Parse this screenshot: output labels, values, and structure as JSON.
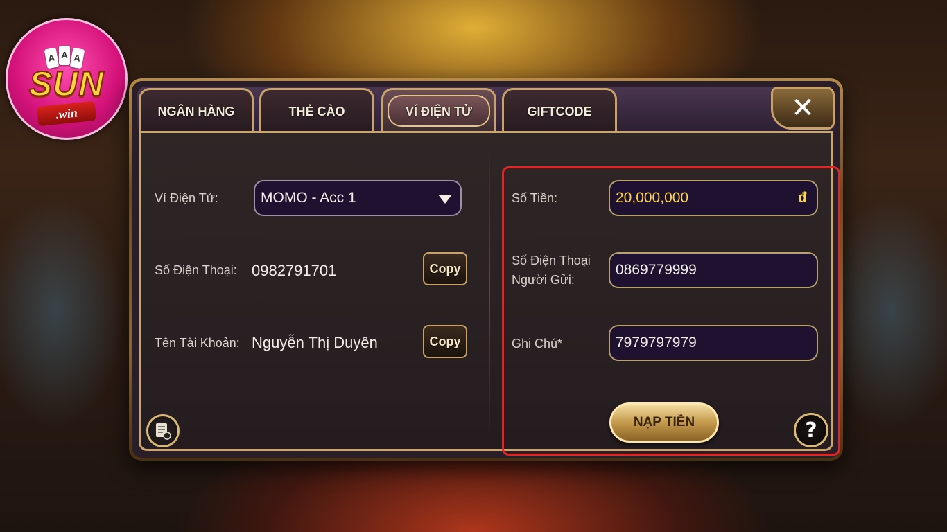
{
  "logo": {
    "brand": "SUN",
    "sub": ".win",
    "cards": [
      "A",
      "A",
      "A"
    ]
  },
  "tabs": [
    {
      "label": "NGÂN HÀNG",
      "active": false
    },
    {
      "label": "THẺ CÀO",
      "active": false
    },
    {
      "label": "VÍ ĐIỆN TỬ",
      "active": true
    },
    {
      "label": "GIFTCODE",
      "active": false
    }
  ],
  "close_icon": "close-icon",
  "left": {
    "wallet_label": "Ví Điện Tử:",
    "wallet_selected": "MOMO - Acc 1",
    "phone_label": "Số Điện Thoại:",
    "phone_value": "0982791701",
    "account_label": "Tên Tài Khoản:",
    "account_value": "Nguyễn Thị Duyên",
    "copy_label": "Copy"
  },
  "right": {
    "amount_label": "Số Tiền:",
    "amount_value": "20,000,000",
    "currency": "đ",
    "sender_label_line1": "Số Điện Thoại",
    "sender_label_line2": "Người Gửi:",
    "sender_value": "0869779999",
    "note_label": "Ghi Chú*",
    "note_value": "7979797979",
    "submit_label": "NẠP TIỀN",
    "help_label": "?"
  },
  "colors": {
    "highlight": "#e02525",
    "gold_text": "#ffd64a",
    "field_bg": "#1e1230"
  }
}
